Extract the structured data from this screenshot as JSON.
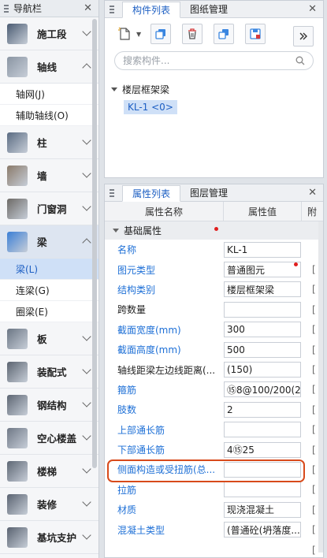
{
  "nav": {
    "title": "导航栏",
    "categories": [
      {
        "label": "施工段",
        "icon": "construction-section-icon",
        "color": "#4a5b72"
      },
      {
        "label": "轴线",
        "icon": "grid-axis-icon",
        "color": "#8a95a3",
        "expanded": true,
        "items": [
          {
            "label": "轴网(J)"
          },
          {
            "label": "辅助轴线(O)"
          }
        ]
      },
      {
        "label": "柱",
        "icon": "column-icon",
        "color": "#5a6b82"
      },
      {
        "label": "墙",
        "icon": "wall-icon",
        "color": "#8a7a6a"
      },
      {
        "label": "门窗洞",
        "icon": "door-window-icon",
        "color": "#6d6a66"
      },
      {
        "label": "梁",
        "icon": "beam-icon",
        "color": "#3b7fd6",
        "expanded": true,
        "selected": true,
        "items": [
          {
            "label": "梁(L)",
            "active": true
          },
          {
            "label": "连梁(G)"
          },
          {
            "label": "圈梁(E)"
          }
        ]
      },
      {
        "label": "板",
        "icon": "slab-icon",
        "color": "#6b7684"
      },
      {
        "label": "装配式",
        "icon": "prefab-icon",
        "color": "#5b6470"
      },
      {
        "label": "钢结构",
        "icon": "steel-structure-icon",
        "color": "#5d6673"
      },
      {
        "label": "空心楼盖",
        "icon": "hollow-floor-icon",
        "color": "#6f7886"
      },
      {
        "label": "楼梯",
        "icon": "stairs-icon",
        "color": "#5e6774"
      },
      {
        "label": "装修",
        "icon": "decoration-icon",
        "color": "#5a6371"
      },
      {
        "label": "基坑支护",
        "icon": "pit-support-icon",
        "color": "#596270"
      }
    ]
  },
  "component_panel": {
    "tabs": [
      {
        "label": "构件列表",
        "active": true
      },
      {
        "label": "图纸管理"
      }
    ],
    "search_placeholder": "搜索构件...",
    "tree": {
      "group": "楼层框架梁",
      "item": "KL-1 <0>"
    }
  },
  "property_panel": {
    "tabs": [
      {
        "label": "属性列表",
        "active": true
      },
      {
        "label": "图层管理"
      }
    ],
    "headers": {
      "name": "属性名称",
      "value": "属性值",
      "extra": "附"
    },
    "group": "基础属性",
    "rows": [
      {
        "name": "名称",
        "value": "KL-1",
        "blue": true,
        "extra": false
      },
      {
        "name": "图元类型",
        "value": "普通图元",
        "blue": true,
        "extra": true,
        "dot": true
      },
      {
        "name": "结构类别",
        "value": "楼层框架梁",
        "blue": true,
        "extra": true
      },
      {
        "name": "跨数量",
        "value": "",
        "blue": false,
        "extra": true
      },
      {
        "name": "截面宽度(mm)",
        "value": "300",
        "blue": true,
        "extra": true
      },
      {
        "name": "截面高度(mm)",
        "value": "500",
        "blue": true,
        "extra": true
      },
      {
        "name": "轴线距梁左边线距离(...",
        "value": "(150)",
        "blue": false,
        "extra": true
      },
      {
        "name": "箍筋",
        "value": "⑮8@100/200(2)",
        "blue": true,
        "extra": true
      },
      {
        "name": "肢数",
        "value": "2",
        "blue": true,
        "extra": true
      },
      {
        "name": "上部通长筋",
        "value": "",
        "blue": true,
        "extra": true
      },
      {
        "name": "下部通长筋",
        "value": "4⑮25",
        "blue": true,
        "extra": true
      },
      {
        "name": "侧面构造或受扭筋(总...",
        "value": "",
        "blue": true,
        "extra": true
      },
      {
        "name": "拉筋",
        "value": "",
        "blue": true,
        "extra": true
      },
      {
        "name": "材质",
        "value": "现浇混凝土",
        "blue": true,
        "extra": true
      },
      {
        "name": "混凝土类型",
        "value": "(普通砼(坍落度...",
        "blue": true,
        "extra": true
      },
      {
        "name": "",
        "value": "",
        "blue": false,
        "extra": true
      }
    ]
  }
}
